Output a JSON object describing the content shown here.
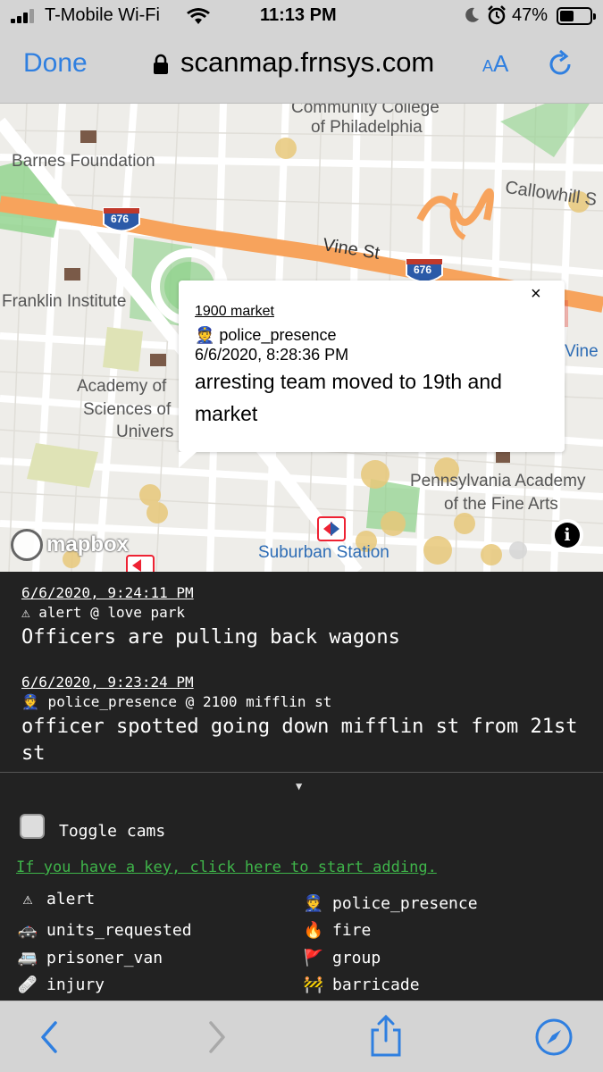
{
  "status_bar": {
    "carrier": "T-Mobile Wi-Fi",
    "time": "11:13 PM",
    "battery": "47%",
    "battery_level": 0.47
  },
  "browser": {
    "done_label": "Done",
    "url": "scanmap.frnsys.com",
    "text_size_label_small": "A",
    "text_size_label_large": "A"
  },
  "map": {
    "labels": {
      "ccp1": "Community College",
      "ccp2": "of Philadelphia",
      "barnes": "Barnes Foundation",
      "callowhill": "Callowhill S",
      "vine_st": "Vine St",
      "franklin": "Franklin Institute",
      "academy1": "Academy of",
      "academy2": "Sciences of",
      "academy3": "Univers",
      "vine_right": "Vine",
      "pafa1": "Pennsylvania Academy",
      "pafa2": "of the Fine Arts",
      "suburban": "Suburban Station",
      "shield_676a": "676",
      "shield_676b": "676"
    },
    "attribution": "mapbox",
    "info_label": "i",
    "popup": {
      "location": "1900 market",
      "type": "👮 police_presence",
      "date": "6/6/2020, 8:28:36 PM",
      "message": "arresting team moved to 19th and market",
      "close_label": "×"
    }
  },
  "feed": {
    "entries": [
      {
        "timestamp": "6/6/2020, 9:24:11 PM",
        "meta": "⚠ alert @ love park",
        "text": "Officers are pulling back wagons"
      },
      {
        "timestamp": "6/6/2020, 9:23:24 PM",
        "meta": "👮 police_presence @ 2100 mifflin st",
        "text": "officer spotted going down mifflin st from 21st st"
      }
    ]
  },
  "legend": {
    "collapse_label": "▼",
    "toggle_cams_label": "Toggle cams",
    "key_link": "If you have a key, click here to start adding.",
    "items": [
      {
        "icon": "⚠",
        "label": "alert"
      },
      {
        "icon": "👮",
        "label": "police_presence"
      },
      {
        "icon": "🚓",
        "label": "units_requested"
      },
      {
        "icon": "🔥",
        "label": "fire"
      },
      {
        "icon": "🚐",
        "label": "prisoner_van"
      },
      {
        "icon": "🚩",
        "label": "group"
      },
      {
        "icon": "🩹",
        "label": "injury"
      },
      {
        "icon": "🚧",
        "label": "barricade"
      }
    ]
  },
  "colors": {
    "ios_blue": "#2f7fe0",
    "link_green": "#3fb54a",
    "highway_orange": "#f7a35c",
    "park_green": "#8dd28a",
    "feed_bg": "#222222"
  }
}
